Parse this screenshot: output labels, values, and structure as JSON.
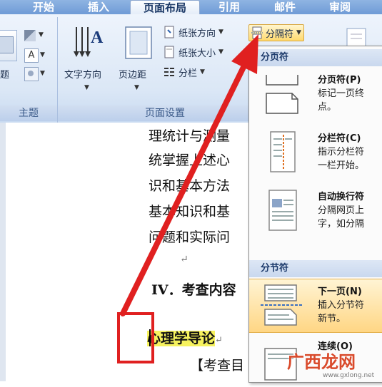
{
  "tabs": [
    "开始",
    "插入",
    "页面布局",
    "引用",
    "邮件",
    "审阅"
  ],
  "ribbon": {
    "theme_group_label": "主题",
    "theme_small_label": "题",
    "text_direction": "文字方向",
    "margins": "页边距",
    "orientation": "纸张方向",
    "size": "纸张大小",
    "columns": "分栏",
    "breaks": "分隔符",
    "page_setup_label": "页面设置"
  },
  "document": {
    "lines": [
      "理统计与测量",
      "统掌握上述心",
      "识和基本方法",
      "基本知识和基",
      "问题和实际问"
    ],
    "return_mark": "↵",
    "heading": "IV．考查内容",
    "highlight": "心理学导论",
    "bracket_line": "【考查目"
  },
  "menu": {
    "page_breaks_header": "分页符",
    "section_breaks_header": "分节符",
    "items": [
      {
        "title": "分页符(P)",
        "desc": "标记一页终\n点。"
      },
      {
        "title": "分栏符(C)",
        "desc": "指示分栏符\n一栏开始。"
      },
      {
        "title": "自动换行符",
        "desc": "分隔网页上\n字，如分隔"
      },
      {
        "title": "下一页(N)",
        "desc": "插入分节符\n新节。"
      },
      {
        "title": "连续(O)",
        "desc": ""
      }
    ]
  },
  "watermark": {
    "text": "广西龙网",
    "url": "www.gxlong.net"
  },
  "colors": {
    "accent_red": "#e02020",
    "ribbon_blue": "#dbe7f6",
    "hover_orange": "#ffd684"
  }
}
